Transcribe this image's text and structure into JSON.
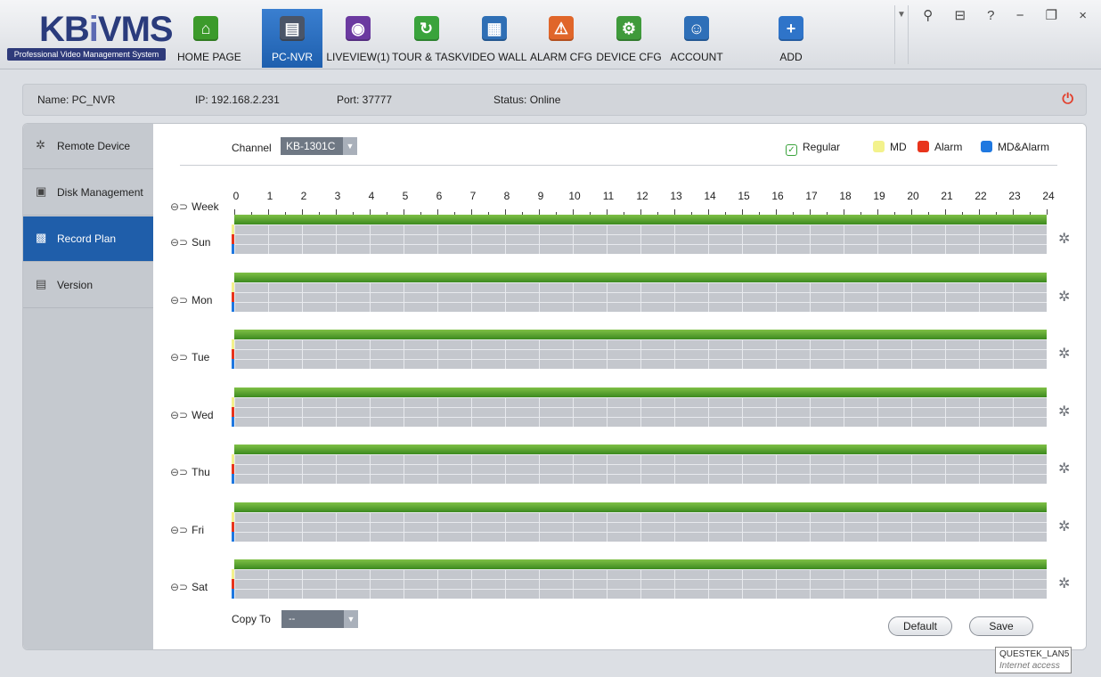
{
  "app": {
    "logo_text_main": "KB",
    "logo_text_i": "i",
    "logo_text_rest": "VMS",
    "tagline": "Professional Video Management System"
  },
  "tabs": [
    {
      "label": "HOME PAGE",
      "icon": "home-icon",
      "color": "#3c9a2b",
      "glyph": "⌂",
      "active": false
    },
    {
      "label": "PC-NVR",
      "icon": "nvr-icon",
      "color": "#4a5568",
      "glyph": "▤",
      "active": true
    },
    {
      "label": "LIVEVIEW(1)",
      "icon": "camera-icon",
      "color": "#6b3aa0",
      "glyph": "◉",
      "active": false
    },
    {
      "label": "TOUR & TASK",
      "icon": "tour-icon",
      "color": "#3aa33c",
      "glyph": "↻",
      "active": false
    },
    {
      "label": "VIDEO WALL",
      "icon": "video-wall-icon",
      "color": "#2f6fb5",
      "glyph": "▦",
      "active": false
    },
    {
      "label": "ALARM CFG",
      "icon": "alarm-icon",
      "color": "#e0662a",
      "glyph": "⚠",
      "active": false
    },
    {
      "label": "DEVICE CFG",
      "icon": "device-icon",
      "color": "#3f9a3b",
      "glyph": "⚙",
      "active": false
    },
    {
      "label": "ACCOUNT",
      "icon": "account-icon",
      "color": "#2e6fb8",
      "glyph": "☺",
      "active": false
    },
    {
      "label": "ADD",
      "icon": "add-icon",
      "color": "#2f74c9",
      "glyph": "+",
      "active": false
    }
  ],
  "window_controls": "⚲ ⊟ ? − ❐ ×",
  "info": {
    "name": "Name:  PC_NVR",
    "ip": "IP:  192.168.2.231",
    "port": "Port:   37777",
    "status": "Status: Online"
  },
  "sidebar": [
    {
      "label": "Remote Device",
      "icon": "gear-icon",
      "glyph": "✲",
      "active": false
    },
    {
      "label": "Disk Management",
      "icon": "disk-icon",
      "glyph": "▣",
      "active": false
    },
    {
      "label": "Record Plan",
      "icon": "clapper-icon",
      "glyph": "▩",
      "active": true
    },
    {
      "label": "Version",
      "icon": "document-icon",
      "glyph": "▤",
      "active": false
    }
  ],
  "channel": {
    "label": "Channel",
    "value": "KB-1301C"
  },
  "legend": [
    {
      "label": "Regular",
      "color": "#ffffff",
      "border": "#3aa33c",
      "check": "✓"
    },
    {
      "label": "MD",
      "color": "#f3f28c"
    },
    {
      "label": "Alarm",
      "color": "#e8341c"
    },
    {
      "label": "MD&Alarm",
      "color": "#1f78e0"
    }
  ],
  "week_label": "Week",
  "hours": [
    "0",
    "1",
    "2",
    "3",
    "4",
    "5",
    "6",
    "7",
    "8",
    "9",
    "10",
    "11",
    "12",
    "13",
    "14",
    "15",
    "16",
    "17",
    "18",
    "19",
    "20",
    "21",
    "22",
    "23",
    "24"
  ],
  "days": [
    "Sun",
    "Mon",
    "Tue",
    "Wed",
    "Thu",
    "Fri",
    "Sat"
  ],
  "copy_to": {
    "label": "Copy To",
    "value": "--"
  },
  "buttons": {
    "default": "Default",
    "save": "Save"
  },
  "tooltip": {
    "line1": "QUESTEK_LAN5",
    "line2": "Internet access"
  }
}
